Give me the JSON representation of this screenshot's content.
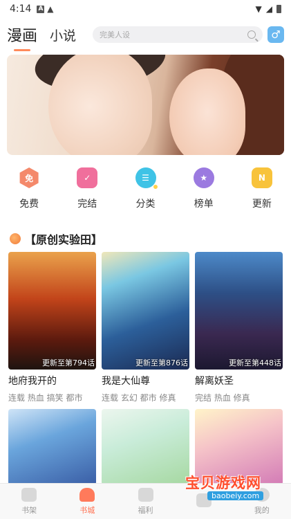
{
  "status_bar": {
    "time": "4:14"
  },
  "header": {
    "tabs": [
      {
        "label": "漫画"
      },
      {
        "label": "小说"
      }
    ],
    "search_placeholder": "完美人设",
    "gender_symbol": "♂"
  },
  "categories": [
    {
      "label": "免费",
      "icon": "free-icon",
      "glyph": "免"
    },
    {
      "label": "完结",
      "icon": "finished-icon",
      "glyph": "✓"
    },
    {
      "label": "分类",
      "icon": "category-icon",
      "glyph": "☰"
    },
    {
      "label": "榜单",
      "icon": "ranking-icon",
      "glyph": "★"
    },
    {
      "label": "更新",
      "icon": "update-icon",
      "glyph": "N"
    }
  ],
  "section": {
    "title": "【原创实验田】"
  },
  "comics": [
    {
      "title": "地府我开的",
      "badge": "更新至第794话",
      "tags": "连载 热血 搞笑 都市"
    },
    {
      "title": "我是大仙尊",
      "badge": "更新至第876话",
      "tags": "连载 玄幻 都市 修真"
    },
    {
      "title": "解离妖圣",
      "badge": "更新至第448话",
      "tags": "完结 热血 修真"
    }
  ],
  "bottom_nav": [
    {
      "label": "书架",
      "active": false
    },
    {
      "label": "书城",
      "active": true
    },
    {
      "label": "福利",
      "active": false
    },
    {
      "label": "",
      "active": false
    },
    {
      "label": "我的",
      "active": false
    }
  ],
  "watermark": {
    "text": "宝贝游戏网",
    "url": "baobeiy.com"
  }
}
